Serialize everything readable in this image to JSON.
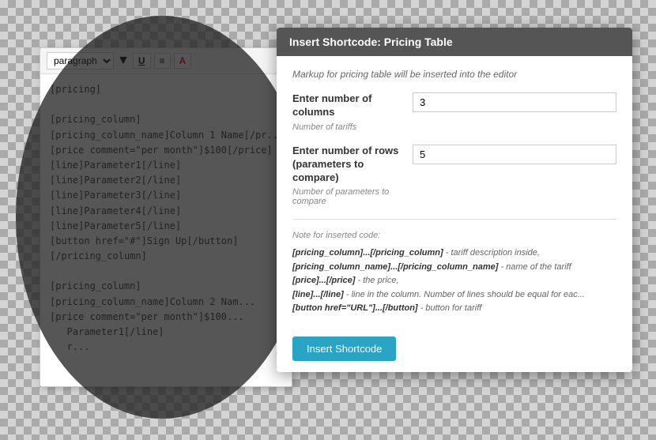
{
  "background": "checkerboard",
  "editor": {
    "toolbar": {
      "paragraph_label": "paragraph",
      "underline_btn": "U",
      "align_btn": "≡",
      "color_btn": "A"
    },
    "content_lines": [
      "[pricing]",
      "",
      "[pricing_column]",
      "[pricing_column_name]Column 1 Name[/pr...",
      "[price comment=\"per month\"]$100[/price]",
      "[line]Parameter1[/line]",
      "[line]Parameter2[/line]",
      "[line]Parameter3[/line]",
      "[line]Parameter4[/line]",
      "[line]Parameter5[/line]",
      "[button href=\"#\"]Sign Up[/button]",
      "[/pricing_column]",
      "",
      "[pricing_column]",
      "[pricing_column_name]Column 2 Nam...",
      "[price comment=\"per month\"]$100...",
      "   Parameter1[/line]",
      "   r..."
    ]
  },
  "modal": {
    "title": "Insert Shortcode: Pricing Table",
    "subtitle": "Markup for pricing table will be inserted into the editor",
    "columns_label": "Enter number of columns",
    "columns_hint": "Number of tariffs",
    "columns_value": "3",
    "rows_label": "Enter number of rows (parameters to compare)",
    "rows_hint": "Number of parameters to compare",
    "rows_value": "5",
    "note_label": "Note for inserted code:",
    "note_items": [
      {
        "code": "[pricing_column]...[/pricing_column]",
        "desc": "- tariff description inside,"
      },
      {
        "code": "[pricing_column_name]...[/pricing_column_name]",
        "desc": "- name of the tariff"
      },
      {
        "code": "[price]...[/price]",
        "desc": "- the price,"
      },
      {
        "code": "[line]...[/line]",
        "desc": "- line in the column. Number of lines should be equal for eac..."
      },
      {
        "code": "[button href=\"URL\"]...[/button]",
        "desc": "- button for tariff"
      }
    ],
    "insert_btn": "Insert Shortcode"
  }
}
